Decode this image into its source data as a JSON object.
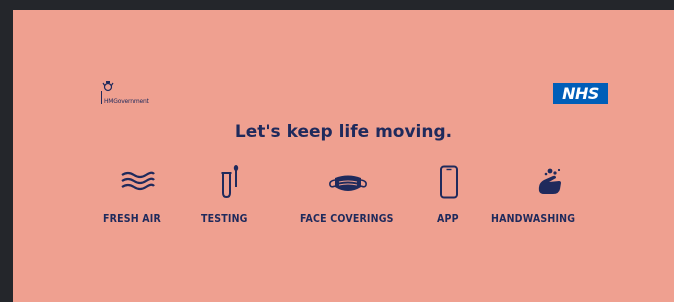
{
  "branding": {
    "left_logo_text": "HMGovernment",
    "right_logo_text": "NHS"
  },
  "headline": "Let's keep life moving.",
  "items": [
    {
      "label": "FRESH AIR",
      "icon": "wind-icon"
    },
    {
      "label": "TESTING",
      "icon": "test-tube-swab-icon"
    },
    {
      "label": "FACE COVERINGS",
      "icon": "face-mask-icon"
    },
    {
      "label": "APP",
      "icon": "smartphone-icon"
    },
    {
      "label": "HANDWASHING",
      "icon": "handwashing-icon"
    }
  ],
  "colors": {
    "background": "#efa090",
    "text": "#1f2a5c",
    "nhs_blue": "#005eb8",
    "frame": "#24262b"
  }
}
